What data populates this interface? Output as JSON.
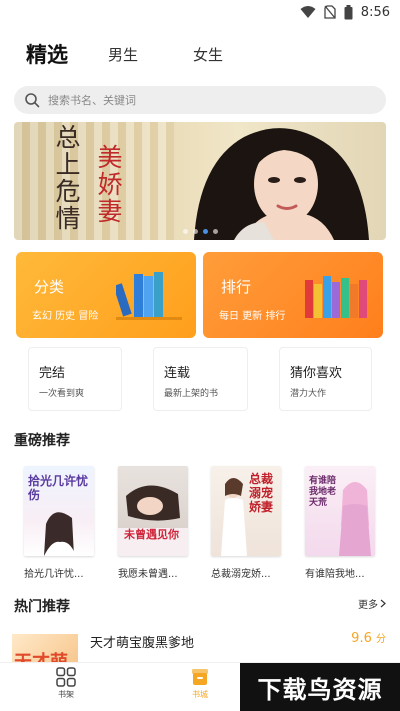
{
  "status_bar": {
    "time": "8:56"
  },
  "top_tabs": {
    "featured": "精选",
    "male": "男生",
    "female": "女生"
  },
  "search": {
    "placeholder": "搜索书名、关键词"
  },
  "banner": {
    "title_line1": "总上危情",
    "title_line2": "美娇妻"
  },
  "cards": {
    "category": {
      "title": "分类",
      "subtitle": "玄幻 历史 冒险"
    },
    "ranking": {
      "title": "排行",
      "subtitle": "每日 更新 排行"
    }
  },
  "boxes": [
    {
      "title": "完结",
      "subtitle": "一次看到爽"
    },
    {
      "title": "连载",
      "subtitle": "最新上架的书"
    },
    {
      "title": "猜你喜欢",
      "subtitle": "潜力大作"
    }
  ],
  "featured_section": {
    "title": "重磅推荐",
    "books": [
      {
        "title": "拾光几许忧...",
        "cover_text": "拾光几许忧伤"
      },
      {
        "title": "我愿未曾遇...",
        "cover_text": "未曾遇见你"
      },
      {
        "title": "总裁溺宠娇...",
        "cover_text": "总裁溺宠娇妻"
      },
      {
        "title": "有谁陪我地...",
        "cover_text": "有谁陪我地老天荒"
      }
    ]
  },
  "hot_section": {
    "title": "热门推荐",
    "more_label": "更多",
    "items": [
      {
        "title": "天才萌宝腹黑爹地",
        "score": "9.6",
        "unit": "分",
        "thumb_text": "天才萌"
      }
    ]
  },
  "bottom_nav": {
    "shelf": "书架",
    "store": "书城"
  },
  "watermark": "下载鸟资源",
  "colors": {
    "accent": "#f5a623",
    "card_orange_1": "#ffb93a",
    "card_orange_2": "#ff8a1c"
  }
}
